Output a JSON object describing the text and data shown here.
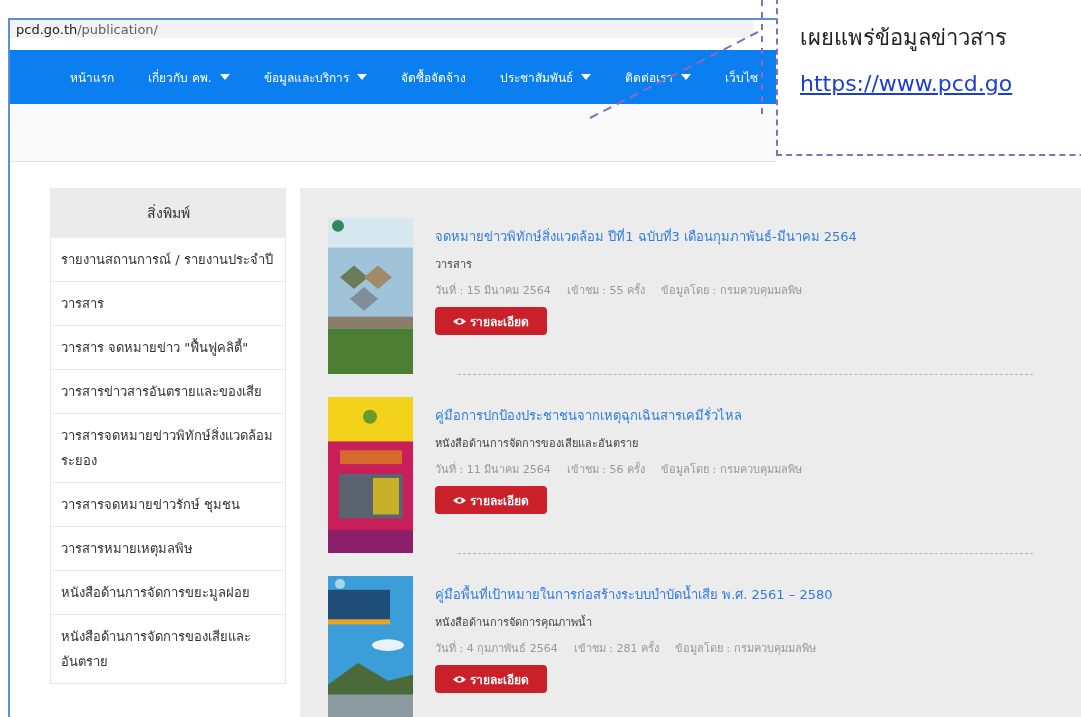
{
  "browser": {
    "address_host": "pcd.go.th",
    "address_path": "/publication/"
  },
  "nav": [
    {
      "label": "หน้าแรก",
      "dropdown": false
    },
    {
      "label": "เกี่ยวกับ คพ.",
      "dropdown": true
    },
    {
      "label": "ข้อมูลและบริการ",
      "dropdown": true
    },
    {
      "label": "จัดซื้อจัดจ้าง",
      "dropdown": false
    },
    {
      "label": "ประชาสัมพันธ์",
      "dropdown": true
    },
    {
      "label": "ติดต่อเรา",
      "dropdown": true
    },
    {
      "label": "เว็บไซ",
      "dropdown": false
    }
  ],
  "sidebar": {
    "title": "สิ่งพิมพ์",
    "items": [
      "รายงานสถานการณ์ / รายงานประจำปี",
      "วารสาร",
      "วารสาร จดหมายข่าว \"ฟื้นฟูคลิตี้\"",
      "วารสารข่าวสารอันตรายและของเสีย",
      "วารสารจดหมายข่าวพิทักษ์สิ่งแวดล้อม ระยอง",
      "วารสารจดหมายข่าวรักษ์ ชุมชน",
      "วารสารหมายเหตุมลพิษ",
      "หนังสือด้านการจัดการขยะมูลฝอย",
      "หนังสือด้านการจัดการของเสียและอันตราย"
    ]
  },
  "publications": [
    {
      "title": "จดหมายข่าวพิทักษ์สิ่งแวดล้อม ปีที่1 ฉบับที่3 เดือนกุมภาพันธ์-มีนาคม 2564",
      "category": "วารสาร",
      "date": "วันที่ : 15 มีนาคม 2564",
      "views": "เข้าชม : 55 ครั้ง",
      "source": "ข้อมูลโดย : กรมควบคุมมลพิษ",
      "button": "รายละเอียด"
    },
    {
      "title": "คู่มือการปกป้องประชาชนจากเหตุฉุกเฉินสารเคมีรั่วไหล",
      "category": "หนังสือด้านการจัดการของเสียและอันตราย",
      "date": "วันที่ : 11 มีนาคม 2564",
      "views": "เข้าชม : 56 ครั้ง",
      "source": "ข้อมูลโดย : กรมควบคุมมลพิษ",
      "button": "รายละเอียด"
    },
    {
      "title": "คู่มือพื้นที่เป้าหมายในการก่อสร้างระบบบำบัดน้ำเสีย พ.ศ. 2561 – 2580",
      "category": "หนังสือด้านการจัดการคุณภาพน้ำ",
      "date": "วันที่ : 4 กุมภาพันธ์ 2564",
      "views": "เข้าชม : 281 ครั้ง",
      "source": "ข้อมูลโดย : กรมควบคุมมลพิษ",
      "button": "รายละเอียด"
    }
  ],
  "callout": {
    "text": "เผยแพร่ข้อมูลข่าวสาร",
    "link": "https://www.pcd.go"
  }
}
